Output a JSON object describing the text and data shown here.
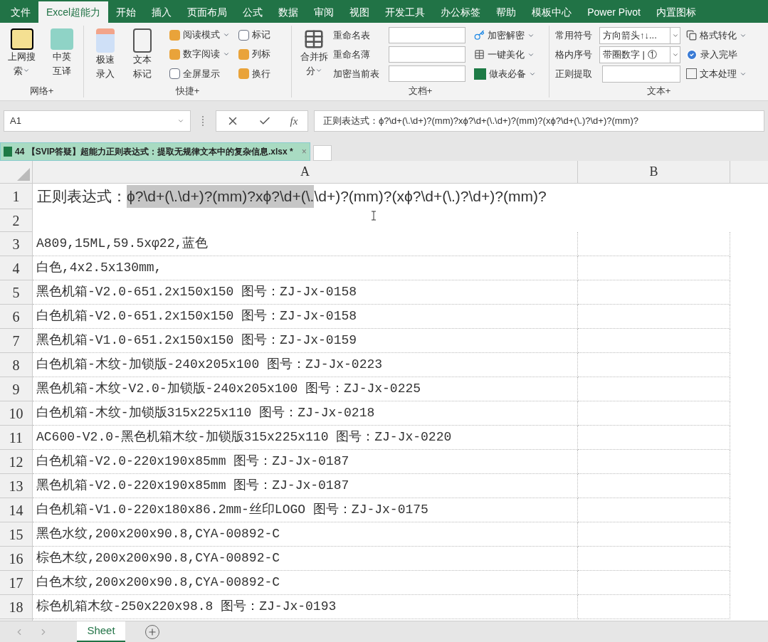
{
  "ribbon_tabs": [
    {
      "label": "文件",
      "selected": false
    },
    {
      "label": "Excel超能力",
      "selected": true
    },
    {
      "label": "开始",
      "selected": false
    },
    {
      "label": "插入",
      "selected": false
    },
    {
      "label": "页面布局",
      "selected": false
    },
    {
      "label": "公式",
      "selected": false
    },
    {
      "label": "数据",
      "selected": false
    },
    {
      "label": "审阅",
      "selected": false
    },
    {
      "label": "视图",
      "selected": false
    },
    {
      "label": "开发工具",
      "selected": false
    },
    {
      "label": "办公标签",
      "selected": false
    },
    {
      "label": "帮助",
      "selected": false
    },
    {
      "label": "模板中心",
      "selected": false
    },
    {
      "label": "Power Pivot",
      "selected": false
    },
    {
      "label": "内置图标",
      "selected": false
    }
  ],
  "network_group": {
    "label": "网络+",
    "buttons": [
      {
        "line1": "上网搜",
        "line2": "索",
        "kind": "dropdown"
      },
      {
        "line1": "中英",
        "line2": "互译",
        "kind": "plain"
      }
    ]
  },
  "quick_group": {
    "label": "快捷+",
    "big_buttons": [
      {
        "line1": "极速",
        "line2": "录入"
      },
      {
        "line1": "文本",
        "line2": "标记"
      }
    ],
    "small_buttons": [
      {
        "label": "阅读模式",
        "kind": "dropdown"
      },
      {
        "label": "数字阅读",
        "kind": "dropdown"
      },
      {
        "label": "全屏显示",
        "kind": "checkbox",
        "checked": false
      },
      {
        "label": "标记",
        "kind": "checkbox",
        "checked": false
      },
      {
        "label": "列标",
        "kind": "plain"
      },
      {
        "label": "换行",
        "kind": "plain"
      }
    ]
  },
  "doc_group": {
    "label": "文档+",
    "merge_button": {
      "line1": "合并拆",
      "line2": "分"
    },
    "fields": [
      "重命名表",
      "重命名薄",
      "加密当前表"
    ],
    "buttons": [
      "加密解密",
      "一键美化",
      "做表必备"
    ]
  },
  "text_group": {
    "label": "文本+",
    "fields": [
      {
        "label": "常用符号",
        "value": "方向箭头↑↓...",
        "kind": "select"
      },
      {
        "label": "格内序号",
        "value": "带圈数字 | ①",
        "kind": "select"
      },
      {
        "label": "正则提取",
        "kind": "input"
      }
    ],
    "buttons": [
      {
        "label": "格式转化",
        "kind": "dropdown"
      },
      {
        "label": "录入完毕",
        "kind": "plain"
      },
      {
        "label": "文本处理",
        "kind": "dropdown"
      }
    ]
  },
  "formula_bar": {
    "name_box": "A1",
    "fx": "fx",
    "formula": "正则表达式：ϕ?\\d+(\\.\\d+)?(mm)?xϕ?\\d+(\\.\\d+)?(mm)?(xϕ?\\d+(\\.)?\\d+)?(mm)?"
  },
  "file_tab": {
    "title": "44 【SVIP答疑】超能力正则表达式：提取无规律文本中的复杂信息.xlsx *",
    "close": "×"
  },
  "columns": [
    "A",
    "B"
  ],
  "fixed_rows": [
    "1",
    "2"
  ],
  "cell_a1": {
    "label": "正则表达式：",
    "selected_text": "ϕ?\\d+(\\.\\d+)?(mm)?xϕ?\\d+(\\.",
    "rest": "\\d+)?(mm)?(xϕ?\\d+(\\.)?\\d+)?(mm)?"
  },
  "rows": [
    {
      "number": "3",
      "a": "A809,15ML,59.5xφ22,蓝色"
    },
    {
      "number": "4",
      "a": "白色,4x2.5x130mm,"
    },
    {
      "number": "5",
      "a": "黑色机箱-V2.0-651.2x150x150 图号：ZJ-Jx-0158"
    },
    {
      "number": "6",
      "a": "白色机箱-V2.0-651.2x150x150 图号：ZJ-Jx-0158"
    },
    {
      "number": "7",
      "a": "黑色机箱-V1.0-651.2x150x150 图号：ZJ-Jx-0159"
    },
    {
      "number": "8",
      "a": "白色机箱-木纹-加锁版-240x205x100 图号：ZJ-Jx-0223"
    },
    {
      "number": "9",
      "a": "黑色机箱-木纹-V2.0-加锁版-240x205x100 图号：ZJ-Jx-0225"
    },
    {
      "number": "10",
      "a": "白色机箱-木纹-加锁版315x225x110 图号：ZJ-Jx-0218"
    },
    {
      "number": "11",
      "a": "AC600-V2.0-黑色机箱木纹-加锁版315x225x110 图号：ZJ-Jx-0220"
    },
    {
      "number": "12",
      "a": "白色机箱-V2.0-220x190x85mm 图号：ZJ-Jx-0187"
    },
    {
      "number": "13",
      "a": "黑色机箱-V2.0-220x190x85mm 图号：ZJ-Jx-0187"
    },
    {
      "number": "14",
      "a": "白色机箱-V1.0-220x180x86.2mm-丝印LOGO 图号：ZJ-Jx-0175"
    },
    {
      "number": "15",
      "a": "黑色水纹,200x200x90.8,CYA-00892-C"
    },
    {
      "number": "16",
      "a": "棕色木纹,200x200x90.8,CYA-00892-C"
    },
    {
      "number": "17",
      "a": "白色木纹,200x200x90.8,CYA-00892-C"
    },
    {
      "number": "18",
      "a": "棕色机箱木纹-250x220x98.8 图号：ZJ-Jx-0193"
    }
  ],
  "sheet_tabs": [
    {
      "label": "Sheet",
      "selected": true
    }
  ]
}
